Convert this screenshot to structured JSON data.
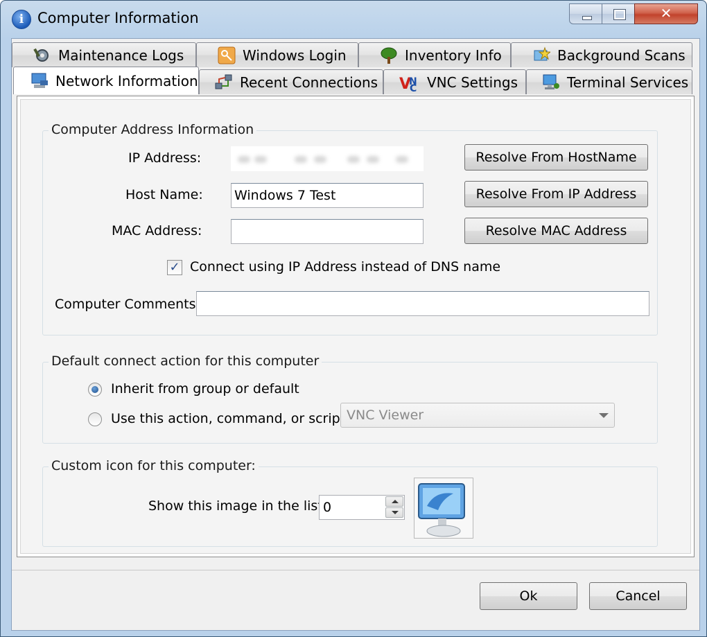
{
  "window": {
    "title": "Computer Information",
    "close_glyph": "✕"
  },
  "tabs_row1": [
    {
      "label": "Maintenance Logs",
      "icon": "wrench-gear-icon"
    },
    {
      "label": "Windows Login",
      "icon": "key-icon"
    },
    {
      "label": "Inventory Info",
      "icon": "tree-icon"
    },
    {
      "label": "Background Scans",
      "icon": "scan-star-icon"
    }
  ],
  "tabs_row2": [
    {
      "label": "Network Information",
      "icon": "network-computer-icon",
      "active": true
    },
    {
      "label": "Recent Connections",
      "icon": "connections-icon"
    },
    {
      "label": "VNC Settings",
      "icon": "vnc-icon"
    },
    {
      "label": "Terminal Services",
      "icon": "terminal-monitor-icon"
    }
  ],
  "address_group": {
    "title": "Computer Address Information",
    "ip_label": "IP Address:",
    "ip_value": "",
    "host_label": "Host Name:",
    "host_value": "Windows 7 Test",
    "mac_label": "MAC Address:",
    "mac_value": "",
    "resolve_hostname": "Resolve From HostName",
    "resolve_ip": "Resolve From IP Address",
    "resolve_mac": "Resolve MAC Address",
    "connect_ip_checkbox": {
      "label": "Connect using IP Address instead of DNS name",
      "checked": true,
      "glyph": "✓"
    },
    "comments_label": "Computer Comments:",
    "comments_value": ""
  },
  "connect_group": {
    "title": "Default connect action for this computer",
    "option_inherit": "Inherit from group or default",
    "option_custom": "Use this action, command, or script:",
    "selected": "inherit",
    "action_combo_value": "VNC Viewer"
  },
  "icon_group": {
    "title": "Custom icon for this computer:",
    "image_label": "Show this image in the list:",
    "image_index": "0"
  },
  "footer": {
    "ok": "Ok",
    "cancel": "Cancel"
  },
  "colors": {
    "title_bar": "#b9d1ea",
    "close_button": "#c2432c",
    "panel_bg": "#f0f0f0",
    "check_color": "#2a4d8c"
  }
}
